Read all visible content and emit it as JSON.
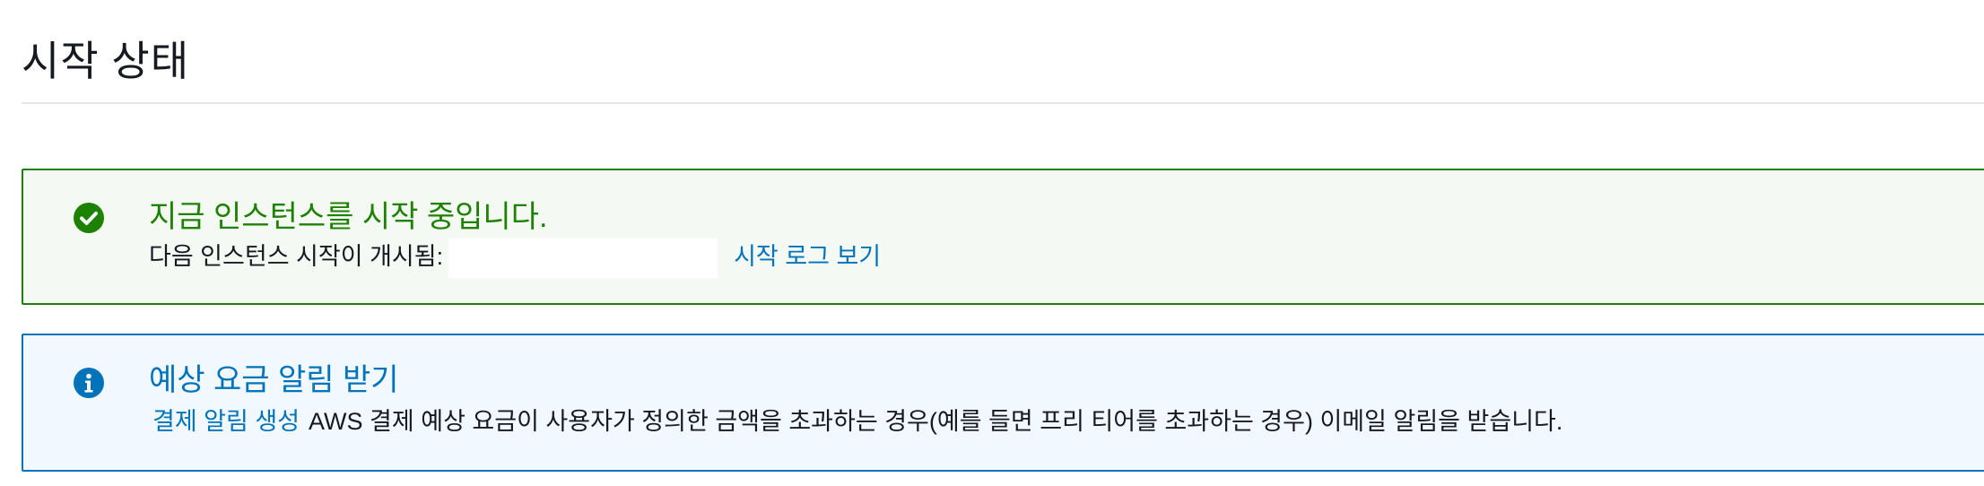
{
  "page": {
    "title": "시작 상태"
  },
  "success_alert": {
    "heading": "지금 인스턴스를 시작 중입니다.",
    "body_prefix": "다음 인스턴스 시작이 개시됨:",
    "instance_id": "",
    "view_log_link": "시작 로그 보기",
    "icon": "check-circle-icon",
    "color": "#1d8102"
  },
  "info_alert": {
    "heading": "예상 요금 알림 받기",
    "create_alert_link": "결제 알림 생성",
    "body_text": "AWS 결제 예상 요금이 사용자가 정의한 금액을 초과하는 경우(예를 들면 프리 티어를 초과하는 경우) 이메일 알림을 받습니다.",
    "icon": "info-circle-icon",
    "color": "#0073bb"
  }
}
